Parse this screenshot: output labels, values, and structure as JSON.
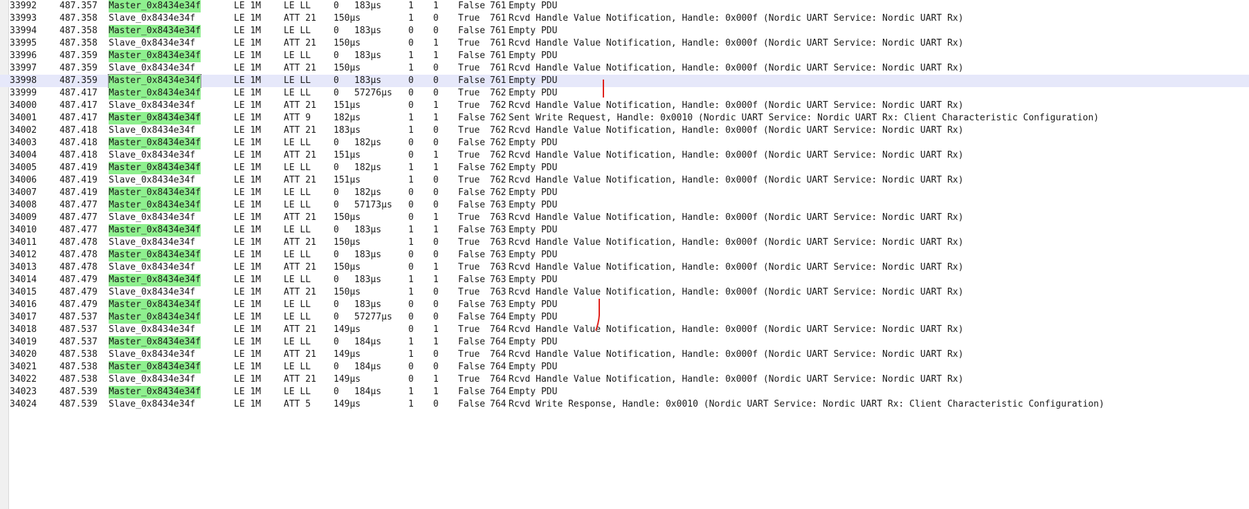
{
  "packets": [
    {
      "no": "33992",
      "time": "487.357",
      "source": "Master_0x8434e34f",
      "role": "master",
      "phy": "LE 1M",
      "proto": "LE LL",
      "len": "0",
      "delta": "183µs",
      "a": "1",
      "b": "1",
      "crc": "False",
      "event": "761",
      "info": "Empty PDU"
    },
    {
      "no": "33993",
      "time": "487.358",
      "source": "Slave_0x8434e34f",
      "role": "slave",
      "phy": "LE 1M",
      "proto": "ATT 21",
      "len": "150µs",
      "delta": "",
      "a": "1",
      "b": "0",
      "crc": "True",
      "event": "761",
      "info": "Rcvd Handle Value Notification, Handle: 0x000f (Nordic UART Service: Nordic UART Rx)"
    },
    {
      "no": "33994",
      "time": "487.358",
      "source": "Master_0x8434e34f",
      "role": "master",
      "phy": "LE 1M",
      "proto": "LE LL",
      "len": "0",
      "delta": "183µs",
      "a": "0",
      "b": "0",
      "crc": "False",
      "event": "761",
      "info": "Empty PDU"
    },
    {
      "no": "33995",
      "time": "487.358",
      "source": "Slave_0x8434e34f",
      "role": "slave",
      "phy": "LE 1M",
      "proto": "ATT 21",
      "len": "150µs",
      "delta": "",
      "a": "0",
      "b": "1",
      "crc": "True",
      "event": "761",
      "info": "Rcvd Handle Value Notification, Handle: 0x000f (Nordic UART Service: Nordic UART Rx)"
    },
    {
      "no": "33996",
      "time": "487.359",
      "source": "Master_0x8434e34f",
      "role": "master",
      "phy": "LE 1M",
      "proto": "LE LL",
      "len": "0",
      "delta": "183µs",
      "a": "1",
      "b": "1",
      "crc": "False",
      "event": "761",
      "info": "Empty PDU"
    },
    {
      "no": "33997",
      "time": "487.359",
      "source": "Slave_0x8434e34f",
      "role": "slave",
      "phy": "LE 1M",
      "proto": "ATT 21",
      "len": "150µs",
      "delta": "",
      "a": "1",
      "b": "0",
      "crc": "True",
      "event": "761",
      "info": "Rcvd Handle Value Notification, Handle: 0x000f (Nordic UART Service: Nordic UART Rx)"
    },
    {
      "no": "33998",
      "time": "487.359",
      "source": "Master_0x8434e34f",
      "role": "master",
      "phy": "LE 1M",
      "proto": "LE LL",
      "len": "0",
      "delta": "183µs",
      "a": "0",
      "b": "0",
      "crc": "False",
      "event": "761",
      "info": "Empty PDU"
    },
    {
      "no": "33999",
      "time": "487.417",
      "source": "Master_0x8434e34f",
      "role": "master",
      "phy": "LE 1M",
      "proto": "LE LL",
      "len": "0",
      "delta": "57276µs",
      "a": "0",
      "b": "0",
      "crc": "True",
      "event": "762",
      "info": "Empty PDU"
    },
    {
      "no": "34000",
      "time": "487.417",
      "source": "Slave_0x8434e34f",
      "role": "slave",
      "phy": "LE 1M",
      "proto": "ATT 21",
      "len": "151µs",
      "delta": "",
      "a": "0",
      "b": "1",
      "crc": "True",
      "event": "762",
      "info": "Rcvd Handle Value Notification, Handle: 0x000f (Nordic UART Service: Nordic UART Rx)"
    },
    {
      "no": "34001",
      "time": "487.417",
      "source": "Master_0x8434e34f",
      "role": "master",
      "phy": "LE 1M",
      "proto": "ATT 9",
      "len": "182µs",
      "delta": "",
      "a": "1",
      "b": "1",
      "crc": "False",
      "event": "762",
      "info": "Sent Write Request, Handle: 0x0010 (Nordic UART Service: Nordic UART Rx: Client Characteristic Configuration)"
    },
    {
      "no": "34002",
      "time": "487.418",
      "source": "Slave_0x8434e34f",
      "role": "slave",
      "phy": "LE 1M",
      "proto": "ATT 21",
      "len": "183µs",
      "delta": "",
      "a": "1",
      "b": "0",
      "crc": "True",
      "event": "762",
      "info": "Rcvd Handle Value Notification, Handle: 0x000f (Nordic UART Service: Nordic UART Rx)"
    },
    {
      "no": "34003",
      "time": "487.418",
      "source": "Master_0x8434e34f",
      "role": "master",
      "phy": "LE 1M",
      "proto": "LE LL",
      "len": "0",
      "delta": "182µs",
      "a": "0",
      "b": "0",
      "crc": "False",
      "event": "762",
      "info": "Empty PDU"
    },
    {
      "no": "34004",
      "time": "487.418",
      "source": "Slave_0x8434e34f",
      "role": "slave",
      "phy": "LE 1M",
      "proto": "ATT 21",
      "len": "151µs",
      "delta": "",
      "a": "0",
      "b": "1",
      "crc": "True",
      "event": "762",
      "info": "Rcvd Handle Value Notification, Handle: 0x000f (Nordic UART Service: Nordic UART Rx)"
    },
    {
      "no": "34005",
      "time": "487.419",
      "source": "Master_0x8434e34f",
      "role": "master",
      "phy": "LE 1M",
      "proto": "LE LL",
      "len": "0",
      "delta": "182µs",
      "a": "1",
      "b": "1",
      "crc": "False",
      "event": "762",
      "info": "Empty PDU"
    },
    {
      "no": "34006",
      "time": "487.419",
      "source": "Slave_0x8434e34f",
      "role": "slave",
      "phy": "LE 1M",
      "proto": "ATT 21",
      "len": "151µs",
      "delta": "",
      "a": "1",
      "b": "0",
      "crc": "True",
      "event": "762",
      "info": "Rcvd Handle Value Notification, Handle: 0x000f (Nordic UART Service: Nordic UART Rx)"
    },
    {
      "no": "34007",
      "time": "487.419",
      "source": "Master_0x8434e34f",
      "role": "master",
      "phy": "LE 1M",
      "proto": "LE LL",
      "len": "0",
      "delta": "182µs",
      "a": "0",
      "b": "0",
      "crc": "False",
      "event": "762",
      "info": "Empty PDU"
    },
    {
      "no": "34008",
      "time": "487.477",
      "source": "Master_0x8434e34f",
      "role": "master",
      "phy": "LE 1M",
      "proto": "LE LL",
      "len": "0",
      "delta": "57173µs",
      "a": "0",
      "b": "0",
      "crc": "False",
      "event": "763",
      "info": "Empty PDU"
    },
    {
      "no": "34009",
      "time": "487.477",
      "source": "Slave_0x8434e34f",
      "role": "slave",
      "phy": "LE 1M",
      "proto": "ATT 21",
      "len": "150µs",
      "delta": "",
      "a": "0",
      "b": "1",
      "crc": "True",
      "event": "763",
      "info": "Rcvd Handle Value Notification, Handle: 0x000f (Nordic UART Service: Nordic UART Rx)"
    },
    {
      "no": "34010",
      "time": "487.477",
      "source": "Master_0x8434e34f",
      "role": "master",
      "phy": "LE 1M",
      "proto": "LE LL",
      "len": "0",
      "delta": "183µs",
      "a": "1",
      "b": "1",
      "crc": "False",
      "event": "763",
      "info": "Empty PDU"
    },
    {
      "no": "34011",
      "time": "487.478",
      "source": "Slave_0x8434e34f",
      "role": "slave",
      "phy": "LE 1M",
      "proto": "ATT 21",
      "len": "150µs",
      "delta": "",
      "a": "1",
      "b": "0",
      "crc": "True",
      "event": "763",
      "info": "Rcvd Handle Value Notification, Handle: 0x000f (Nordic UART Service: Nordic UART Rx)"
    },
    {
      "no": "34012",
      "time": "487.478",
      "source": "Master_0x8434e34f",
      "role": "master",
      "phy": "LE 1M",
      "proto": "LE LL",
      "len": "0",
      "delta": "183µs",
      "a": "0",
      "b": "0",
      "crc": "False",
      "event": "763",
      "info": "Empty PDU"
    },
    {
      "no": "34013",
      "time": "487.478",
      "source": "Slave_0x8434e34f",
      "role": "slave",
      "phy": "LE 1M",
      "proto": "ATT 21",
      "len": "150µs",
      "delta": "",
      "a": "0",
      "b": "1",
      "crc": "True",
      "event": "763",
      "info": "Rcvd Handle Value Notification, Handle: 0x000f (Nordic UART Service: Nordic UART Rx)"
    },
    {
      "no": "34014",
      "time": "487.479",
      "source": "Master_0x8434e34f",
      "role": "master",
      "phy": "LE 1M",
      "proto": "LE LL",
      "len": "0",
      "delta": "183µs",
      "a": "1",
      "b": "1",
      "crc": "False",
      "event": "763",
      "info": "Empty PDU"
    },
    {
      "no": "34015",
      "time": "487.479",
      "source": "Slave_0x8434e34f",
      "role": "slave",
      "phy": "LE 1M",
      "proto": "ATT 21",
      "len": "150µs",
      "delta": "",
      "a": "1",
      "b": "0",
      "crc": "True",
      "event": "763",
      "info": "Rcvd Handle Value Notification, Handle: 0x000f (Nordic UART Service: Nordic UART Rx)"
    },
    {
      "no": "34016",
      "time": "487.479",
      "source": "Master_0x8434e34f",
      "role": "master",
      "phy": "LE 1M",
      "proto": "LE LL",
      "len": "0",
      "delta": "183µs",
      "a": "0",
      "b": "0",
      "crc": "False",
      "event": "763",
      "info": "Empty PDU"
    },
    {
      "no": "34017",
      "time": "487.537",
      "source": "Master_0x8434e34f",
      "role": "master",
      "phy": "LE 1M",
      "proto": "LE LL",
      "len": "0",
      "delta": "57277µs",
      "a": "0",
      "b": "0",
      "crc": "False",
      "event": "764",
      "info": "Empty PDU"
    },
    {
      "no": "34018",
      "time": "487.537",
      "source": "Slave_0x8434e34f",
      "role": "slave",
      "phy": "LE 1M",
      "proto": "ATT 21",
      "len": "149µs",
      "delta": "",
      "a": "0",
      "b": "1",
      "crc": "True",
      "event": "764",
      "info": "Rcvd Handle Value Notification, Handle: 0x000f (Nordic UART Service: Nordic UART Rx)"
    },
    {
      "no": "34019",
      "time": "487.537",
      "source": "Master_0x8434e34f",
      "role": "master",
      "phy": "LE 1M",
      "proto": "LE LL",
      "len": "0",
      "delta": "184µs",
      "a": "1",
      "b": "1",
      "crc": "False",
      "event": "764",
      "info": "Empty PDU"
    },
    {
      "no": "34020",
      "time": "487.538",
      "source": "Slave_0x8434e34f",
      "role": "slave",
      "phy": "LE 1M",
      "proto": "ATT 21",
      "len": "149µs",
      "delta": "",
      "a": "1",
      "b": "0",
      "crc": "True",
      "event": "764",
      "info": "Rcvd Handle Value Notification, Handle: 0x000f (Nordic UART Service: Nordic UART Rx)"
    },
    {
      "no": "34021",
      "time": "487.538",
      "source": "Master_0x8434e34f",
      "role": "master",
      "phy": "LE 1M",
      "proto": "LE LL",
      "len": "0",
      "delta": "184µs",
      "a": "0",
      "b": "0",
      "crc": "False",
      "event": "764",
      "info": "Empty PDU"
    },
    {
      "no": "34022",
      "time": "487.538",
      "source": "Slave_0x8434e34f",
      "role": "slave",
      "phy": "LE 1M",
      "proto": "ATT 21",
      "len": "149µs",
      "delta": "",
      "a": "0",
      "b": "1",
      "crc": "True",
      "event": "764",
      "info": "Rcvd Handle Value Notification, Handle: 0x000f (Nordic UART Service: Nordic UART Rx)"
    },
    {
      "no": "34023",
      "time": "487.539",
      "source": "Master_0x8434e34f",
      "role": "master",
      "phy": "LE 1M",
      "proto": "LE LL",
      "len": "0",
      "delta": "184µs",
      "a": "1",
      "b": "1",
      "crc": "False",
      "event": "764",
      "info": "Empty PDU"
    },
    {
      "no": "34024",
      "time": "487.539",
      "source": "Slave_0x8434e34f",
      "role": "slave",
      "phy": "LE 1M",
      "proto": "ATT 5",
      "len": "149µs",
      "delta": "",
      "a": "1",
      "b": "0",
      "crc": "False",
      "event": "764",
      "info": "Rcvd Write Response, Handle: 0x0010 (Nordic UART Service: Nordic UART Rx: Client Characteristic Configuration)"
    }
  ],
  "selected_no": "33998",
  "colors": {
    "master_highlight": "#8ff08f",
    "selected_row": "#e6e8fa",
    "annotation": "#e0201a"
  }
}
